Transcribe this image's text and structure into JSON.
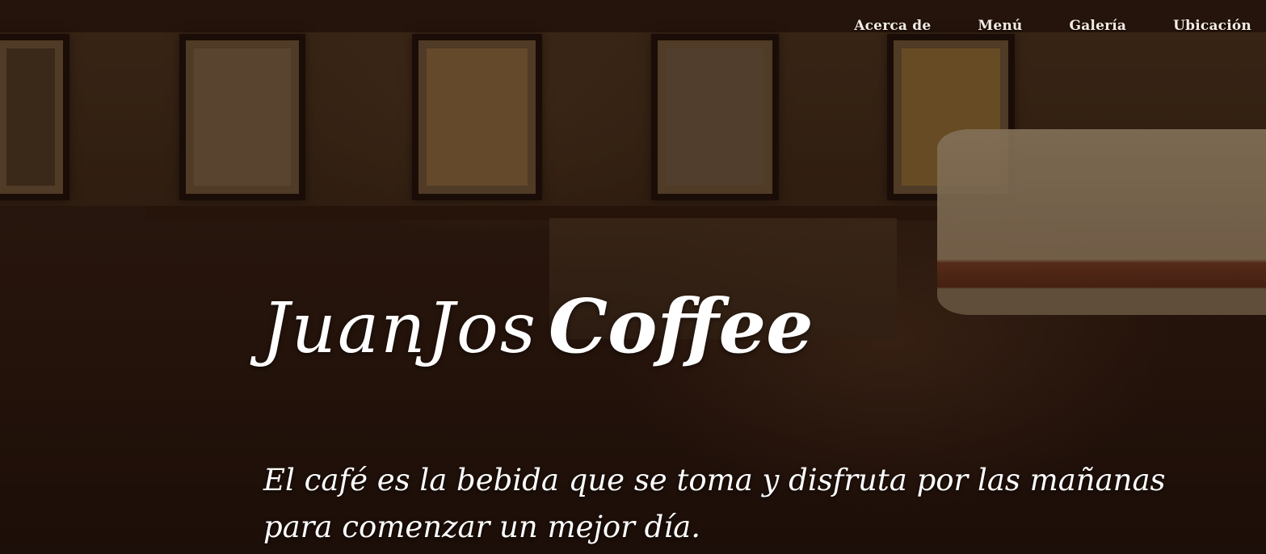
{
  "nav": {
    "items": [
      {
        "label": "Acerca de"
      },
      {
        "label": "Menú"
      },
      {
        "label": "Galería"
      },
      {
        "label": "Ubicación"
      }
    ]
  },
  "hero": {
    "title_light": "JuanJos",
    "title_bold": "Coffee",
    "tagline": "El café es la bebida que se toma y disfruta por las mañanas para comenzar un mejor día."
  },
  "colors": {
    "text": "#ffffff",
    "background_tint": "#1c0f08"
  }
}
